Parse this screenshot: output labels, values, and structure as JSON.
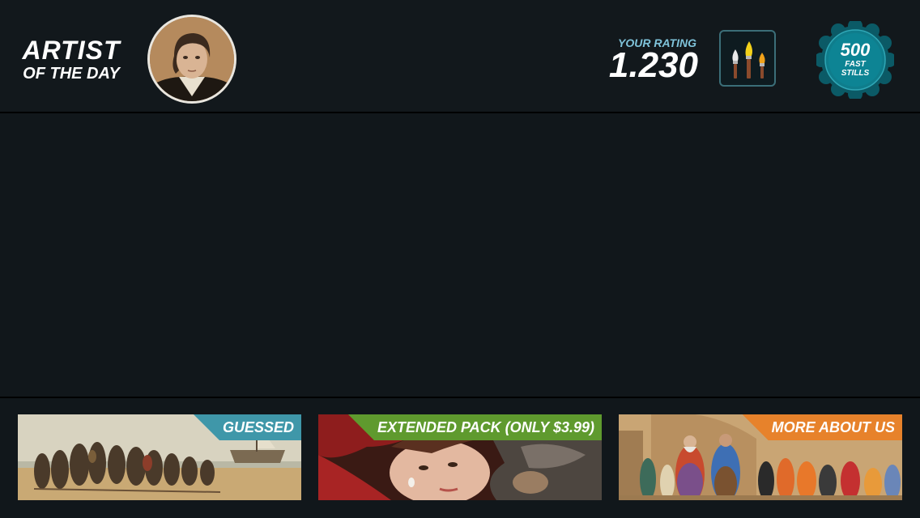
{
  "header": {
    "artist_of_day_line1": "ARTIST",
    "artist_of_day_line2": "OF THE DAY",
    "rating_label": "YOUR RATING",
    "rating_value": "1.230",
    "badge": {
      "number": "500",
      "line1": "FAST",
      "line2": "STILLS",
      "color": "#0f7d8c"
    }
  },
  "tiles": [
    {
      "label": "GUESSED",
      "ribbon_color": "#3f97a9"
    },
    {
      "label": "EXTENDED PACK (ONLY $3.99)",
      "ribbon_color": "#5f9a2e"
    },
    {
      "label": "MORE ABOUT US",
      "ribbon_color": "#e7822b"
    }
  ]
}
